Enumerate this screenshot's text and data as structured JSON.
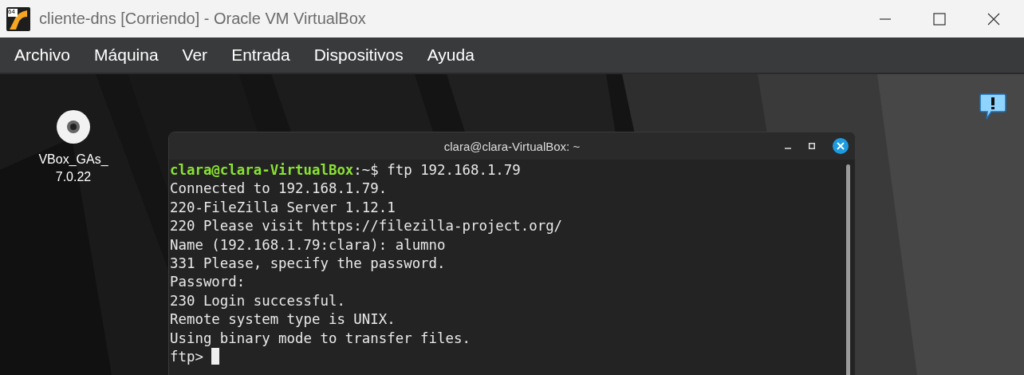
{
  "window": {
    "title": "cliente-dns [Corriendo] - Oracle VM VirtualBox",
    "app_icon_badge": "64"
  },
  "menu": [
    "Archivo",
    "Máquina",
    "Ver",
    "Entrada",
    "Dispositivos",
    "Ayuda"
  ],
  "desktop": {
    "icons": [
      {
        "label_lines": [
          "VBox_GAs_",
          "7.0.22"
        ]
      }
    ]
  },
  "terminal": {
    "title": "clara@clara-VirtualBox: ~",
    "lines": [
      {
        "kind": "prompt",
        "user_host": "clara@clara-VirtualBox",
        "separator": ":",
        "path": "~",
        "symbol": "$",
        "command": "ftp 192.168.1.79"
      },
      {
        "kind": "output",
        "text": "Connected to 192.168.1.79."
      },
      {
        "kind": "output",
        "text": "220-FileZilla Server 1.12.1"
      },
      {
        "kind": "output",
        "text": "220 Please visit https://filezilla-project.org/"
      },
      {
        "kind": "output",
        "text": "Name (192.168.1.79:clara): alumno"
      },
      {
        "kind": "output",
        "text": "331 Please, specify the password."
      },
      {
        "kind": "output",
        "text": "Password:"
      },
      {
        "kind": "output",
        "text": "230 Login successful."
      },
      {
        "kind": "output",
        "text": "Remote system type is UNIX."
      },
      {
        "kind": "output",
        "text": "Using binary mode to transfer files."
      },
      {
        "kind": "input",
        "text": "ftp>",
        "cursor": true
      }
    ]
  }
}
